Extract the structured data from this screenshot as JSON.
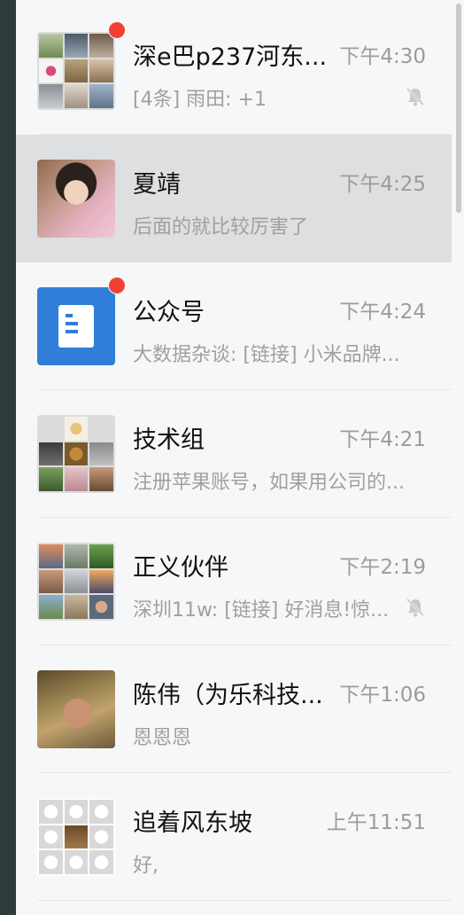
{
  "chats": [
    {
      "name": "深e巴p237河东...",
      "time": "下午4:30",
      "preview": "[4条] 雨田: +1",
      "unread": true,
      "muted": true,
      "avatar": "group-grid",
      "selected": false
    },
    {
      "name": "夏靖",
      "time": "下午4:25",
      "preview": "后面的就比较厉害了",
      "unread": false,
      "muted": false,
      "avatar": "person-photo",
      "selected": true
    },
    {
      "name": "公众号",
      "time": "下午4:24",
      "preview": "大数据杂谈: [链接] 小米品牌...",
      "unread": true,
      "muted": false,
      "avatar": "official-accounts-icon",
      "selected": false
    },
    {
      "name": "技术组",
      "time": "下午4:21",
      "preview": "注册苹果账号，如果用公司的...",
      "unread": false,
      "muted": false,
      "avatar": "group-grid",
      "selected": false
    },
    {
      "name": "正义伙伴",
      "time": "下午2:19",
      "preview": "深圳11w: [链接] 好消息!惊...",
      "unread": false,
      "muted": true,
      "avatar": "group-grid",
      "selected": false
    },
    {
      "name": "陈伟（为乐科技...",
      "time": "下午1:06",
      "preview": "恩恩恩",
      "unread": false,
      "muted": false,
      "avatar": "person-photo",
      "selected": false
    },
    {
      "name": "追着风东坡",
      "time": "上午11:51",
      "preview": "好,",
      "unread": false,
      "muted": false,
      "avatar": "group-grid",
      "selected": false
    }
  ],
  "colors": {
    "badge": "#f04134",
    "selected_row": "#dedfe1",
    "official_accounts_blue": "#2f7fd8"
  }
}
